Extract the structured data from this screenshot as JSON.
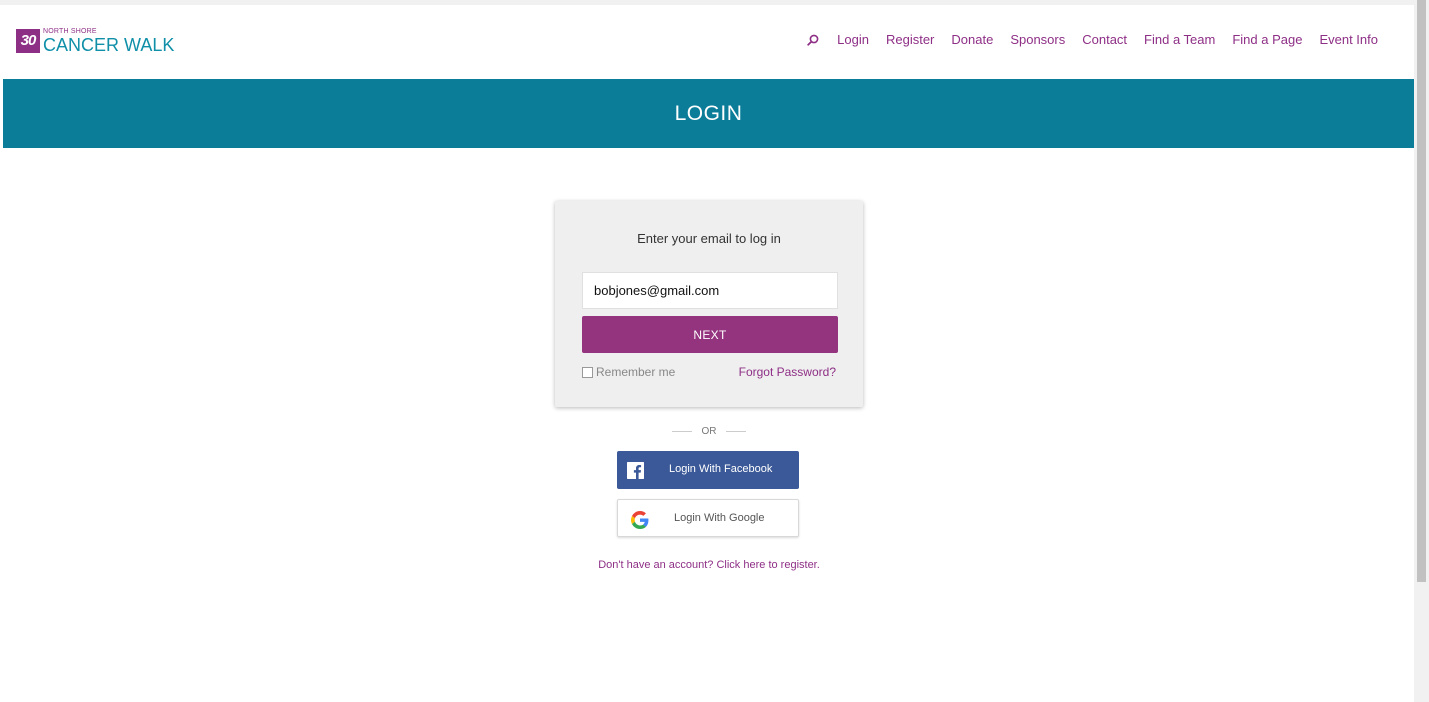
{
  "header": {
    "logo": {
      "badge": "30",
      "small_text": "NORTH SHORE",
      "big_text": "CANCER WALK"
    },
    "nav": {
      "search_icon": "search-icon",
      "items": [
        {
          "label": "Login"
        },
        {
          "label": "Register"
        },
        {
          "label": "Donate"
        },
        {
          "label": "Sponsors"
        },
        {
          "label": "Contact"
        },
        {
          "label": "Find a Team"
        },
        {
          "label": "Find a Page"
        },
        {
          "label": "Event Info"
        }
      ]
    }
  },
  "banner": {
    "title": "LOGIN"
  },
  "login_card": {
    "title": "Enter your email to log in",
    "email_value": "bobjones@gmail.com",
    "next_label": "NEXT",
    "remember_label": "Remember me",
    "remember_checked": false,
    "forgot_label": "Forgot Password?"
  },
  "divider": {
    "label": "OR"
  },
  "social": {
    "facebook_label": "Login With Facebook",
    "google_label": "Login With Google"
  },
  "register_link": "Don't have an account? Click here to register.",
  "colors": {
    "brand_purple": "#8e2f86",
    "banner_teal": "#0b7d99",
    "facebook_blue": "#3b5998",
    "next_button": "#94337e"
  }
}
